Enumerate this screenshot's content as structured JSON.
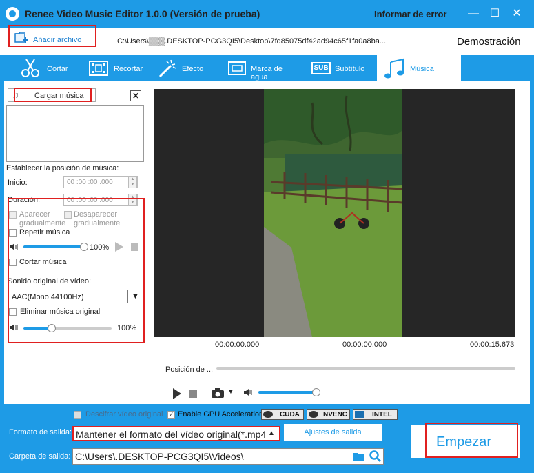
{
  "window": {
    "title": "Renee Video Music Editor 1.0.0 (Versión de prueba)",
    "report_error": "Informar de error",
    "controls": {
      "minimize": "—",
      "maximize": "☐",
      "close": "✕"
    }
  },
  "toolbar": {
    "add_file": "Añadir archivo",
    "path": "C:\\Users\\▒▒▒.DESKTOP-PCG3QI5\\Desktop\\7fd85075df42ad94c65f1fa0a8ba...",
    "demo": "Demostración"
  },
  "tabs": [
    {
      "label": "Cortar",
      "icon": "scissors-icon"
    },
    {
      "label": "Recortar",
      "icon": "film-crop-icon"
    },
    {
      "label": "Efecto",
      "icon": "magic-wand-icon"
    },
    {
      "label": "Marca de agua",
      "icon": "watermark-icon"
    },
    {
      "label": "Subtítulo",
      "icon": "subtitle-icon",
      "badge": "SUB"
    },
    {
      "label": "Música",
      "icon": "music-note-icon",
      "active": true
    }
  ],
  "music_panel": {
    "load_music": "Cargar música",
    "position_heading": "Establecer la posición de música:",
    "start_label": "Inicio:",
    "start_value": "00 :00 :00 .000",
    "duration_label": "Duración:",
    "duration_value": "00 :00 :00 .000",
    "fade_in": "Aparecer gradualmente",
    "fade_out": "Desaparecer gradualmente",
    "repeat": "Repetir música",
    "music_volume": "100%",
    "music_volume_level": 1.0,
    "cut_music": "Cortar música",
    "original_sound_heading": "Sonido original de vídeo:",
    "codec_value": "AAC(Mono 44100Hz)",
    "remove_original": "Eliminar música original",
    "original_volume": "100%",
    "original_volume_level": 0.32
  },
  "player": {
    "time_start": "00:00:00.000",
    "time_current": "00:00:00.000",
    "time_end": "00:00:15.673",
    "position_label": "Posición de ...",
    "player_volume_level": 1.0
  },
  "bottom": {
    "decrypt_video": "Descifrar vídeo original",
    "gpu_acceleration": "Enable GPU Acceleration",
    "gpu_badges": [
      "CUDA",
      "NVENC",
      "INTEL"
    ],
    "format_label": "Formato de salida:",
    "format_value": "Mantener el formato del vídeo original(*.mp4)",
    "output_settings": "Ajustes de salida",
    "folder_label": "Carpeta de salida:",
    "folder_value": "C:\\Users\\.DESKTOP-PCG3QI5\\Videos\\",
    "start": "Empezar"
  },
  "colors": {
    "accent": "#1e9be6",
    "highlight": "#e02020"
  }
}
